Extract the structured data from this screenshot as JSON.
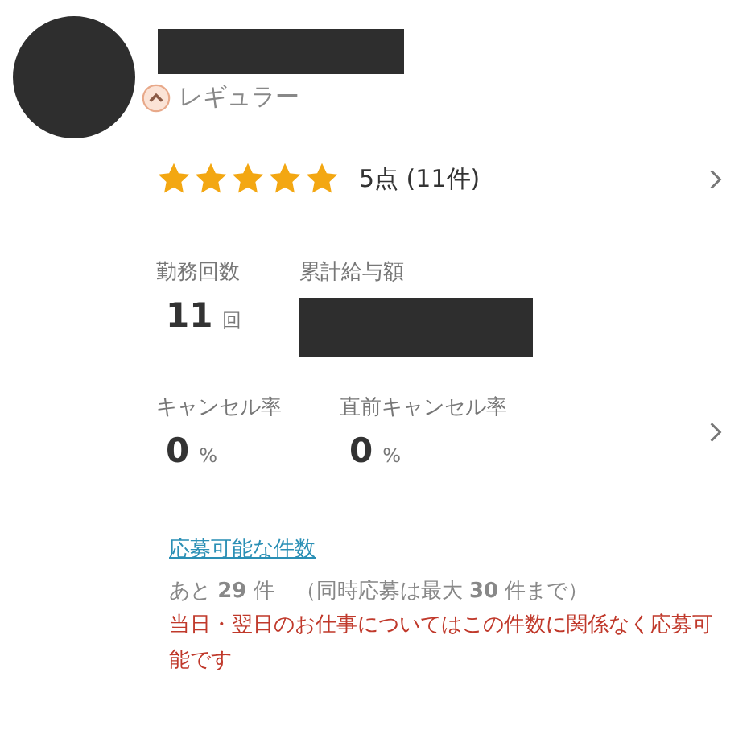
{
  "profile": {
    "name_redacted": true,
    "rank": "レギュラー"
  },
  "rating": {
    "stars": 5,
    "text": "5点 (11件)"
  },
  "stats": [
    {
      "label": "勤務回数",
      "value": "11",
      "unit": "回",
      "redacted": false
    },
    {
      "label": "累計給与額",
      "redacted": true
    }
  ],
  "cancel_stats": [
    {
      "label": "キャンセル率",
      "value": "0",
      "unit": "%"
    },
    {
      "label": "直前キャンセル率",
      "value": "0",
      "unit": "%"
    }
  ],
  "applications": {
    "link": "応募可能な件数",
    "count_text": "あと **29** 件　（同時応募は最大 **30** 件まで）",
    "note": "当日・翌日のお仕事についてはこの件数に関係なく応募可能です"
  }
}
